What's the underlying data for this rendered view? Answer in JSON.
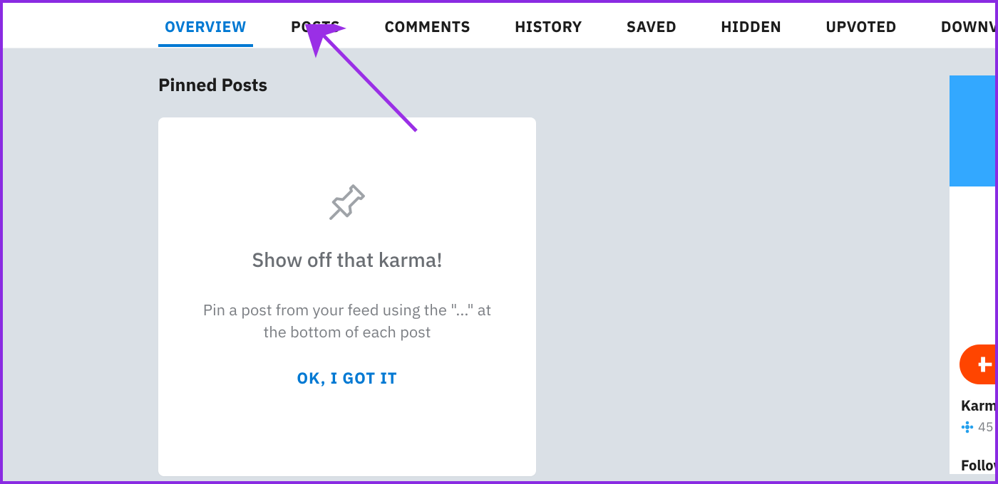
{
  "tabs": {
    "items": [
      {
        "label": "OVERVIEW",
        "active": true
      },
      {
        "label": "POSTS",
        "active": false
      },
      {
        "label": "COMMENTS",
        "active": false
      },
      {
        "label": "HISTORY",
        "active": false
      },
      {
        "label": "SAVED",
        "active": false
      },
      {
        "label": "HIDDEN",
        "active": false
      },
      {
        "label": "UPVOTED",
        "active": false
      },
      {
        "label": "DOWNVOTED",
        "active": false
      }
    ]
  },
  "section": {
    "title": "Pinned Posts"
  },
  "pin_card": {
    "title": "Show off that karma!",
    "description": "Pin a post from your feed using the \"...\" at the bottom of each post",
    "ok_label": "OK, I GOT IT"
  },
  "sidebar": {
    "karma_label": "Karma",
    "karma_value": "45",
    "followers_label": "Followers"
  }
}
